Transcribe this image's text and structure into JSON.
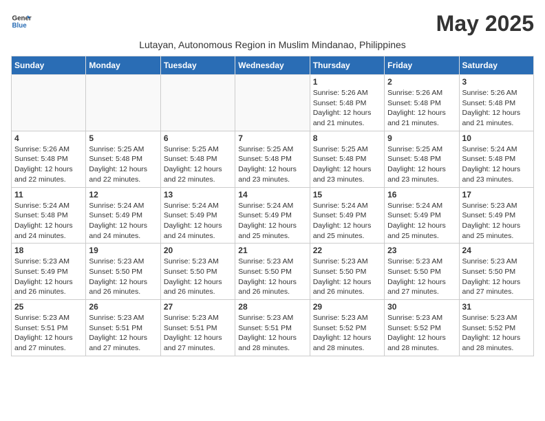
{
  "logo": {
    "line1": "General",
    "line2": "Blue"
  },
  "title": "May 2025",
  "subtitle": "Lutayan, Autonomous Region in Muslim Mindanao, Philippines",
  "weekdays": [
    "Sunday",
    "Monday",
    "Tuesday",
    "Wednesday",
    "Thursday",
    "Friday",
    "Saturday"
  ],
  "weeks": [
    [
      {
        "day": "",
        "info": ""
      },
      {
        "day": "",
        "info": ""
      },
      {
        "day": "",
        "info": ""
      },
      {
        "day": "",
        "info": ""
      },
      {
        "day": "1",
        "info": "Sunrise: 5:26 AM\nSunset: 5:48 PM\nDaylight: 12 hours and 21 minutes."
      },
      {
        "day": "2",
        "info": "Sunrise: 5:26 AM\nSunset: 5:48 PM\nDaylight: 12 hours and 21 minutes."
      },
      {
        "day": "3",
        "info": "Sunrise: 5:26 AM\nSunset: 5:48 PM\nDaylight: 12 hours and 21 minutes."
      }
    ],
    [
      {
        "day": "4",
        "info": "Sunrise: 5:26 AM\nSunset: 5:48 PM\nDaylight: 12 hours and 22 minutes."
      },
      {
        "day": "5",
        "info": "Sunrise: 5:25 AM\nSunset: 5:48 PM\nDaylight: 12 hours and 22 minutes."
      },
      {
        "day": "6",
        "info": "Sunrise: 5:25 AM\nSunset: 5:48 PM\nDaylight: 12 hours and 22 minutes."
      },
      {
        "day": "7",
        "info": "Sunrise: 5:25 AM\nSunset: 5:48 PM\nDaylight: 12 hours and 23 minutes."
      },
      {
        "day": "8",
        "info": "Sunrise: 5:25 AM\nSunset: 5:48 PM\nDaylight: 12 hours and 23 minutes."
      },
      {
        "day": "9",
        "info": "Sunrise: 5:25 AM\nSunset: 5:48 PM\nDaylight: 12 hours and 23 minutes."
      },
      {
        "day": "10",
        "info": "Sunrise: 5:24 AM\nSunset: 5:48 PM\nDaylight: 12 hours and 23 minutes."
      }
    ],
    [
      {
        "day": "11",
        "info": "Sunrise: 5:24 AM\nSunset: 5:48 PM\nDaylight: 12 hours and 24 minutes."
      },
      {
        "day": "12",
        "info": "Sunrise: 5:24 AM\nSunset: 5:49 PM\nDaylight: 12 hours and 24 minutes."
      },
      {
        "day": "13",
        "info": "Sunrise: 5:24 AM\nSunset: 5:49 PM\nDaylight: 12 hours and 24 minutes."
      },
      {
        "day": "14",
        "info": "Sunrise: 5:24 AM\nSunset: 5:49 PM\nDaylight: 12 hours and 25 minutes."
      },
      {
        "day": "15",
        "info": "Sunrise: 5:24 AM\nSunset: 5:49 PM\nDaylight: 12 hours and 25 minutes."
      },
      {
        "day": "16",
        "info": "Sunrise: 5:24 AM\nSunset: 5:49 PM\nDaylight: 12 hours and 25 minutes."
      },
      {
        "day": "17",
        "info": "Sunrise: 5:23 AM\nSunset: 5:49 PM\nDaylight: 12 hours and 25 minutes."
      }
    ],
    [
      {
        "day": "18",
        "info": "Sunrise: 5:23 AM\nSunset: 5:49 PM\nDaylight: 12 hours and 26 minutes."
      },
      {
        "day": "19",
        "info": "Sunrise: 5:23 AM\nSunset: 5:50 PM\nDaylight: 12 hours and 26 minutes."
      },
      {
        "day": "20",
        "info": "Sunrise: 5:23 AM\nSunset: 5:50 PM\nDaylight: 12 hours and 26 minutes."
      },
      {
        "day": "21",
        "info": "Sunrise: 5:23 AM\nSunset: 5:50 PM\nDaylight: 12 hours and 26 minutes."
      },
      {
        "day": "22",
        "info": "Sunrise: 5:23 AM\nSunset: 5:50 PM\nDaylight: 12 hours and 26 minutes."
      },
      {
        "day": "23",
        "info": "Sunrise: 5:23 AM\nSunset: 5:50 PM\nDaylight: 12 hours and 27 minutes."
      },
      {
        "day": "24",
        "info": "Sunrise: 5:23 AM\nSunset: 5:50 PM\nDaylight: 12 hours and 27 minutes."
      }
    ],
    [
      {
        "day": "25",
        "info": "Sunrise: 5:23 AM\nSunset: 5:51 PM\nDaylight: 12 hours and 27 minutes."
      },
      {
        "day": "26",
        "info": "Sunrise: 5:23 AM\nSunset: 5:51 PM\nDaylight: 12 hours and 27 minutes."
      },
      {
        "day": "27",
        "info": "Sunrise: 5:23 AM\nSunset: 5:51 PM\nDaylight: 12 hours and 27 minutes."
      },
      {
        "day": "28",
        "info": "Sunrise: 5:23 AM\nSunset: 5:51 PM\nDaylight: 12 hours and 28 minutes."
      },
      {
        "day": "29",
        "info": "Sunrise: 5:23 AM\nSunset: 5:52 PM\nDaylight: 12 hours and 28 minutes."
      },
      {
        "day": "30",
        "info": "Sunrise: 5:23 AM\nSunset: 5:52 PM\nDaylight: 12 hours and 28 minutes."
      },
      {
        "day": "31",
        "info": "Sunrise: 5:23 AM\nSunset: 5:52 PM\nDaylight: 12 hours and 28 minutes."
      }
    ]
  ]
}
